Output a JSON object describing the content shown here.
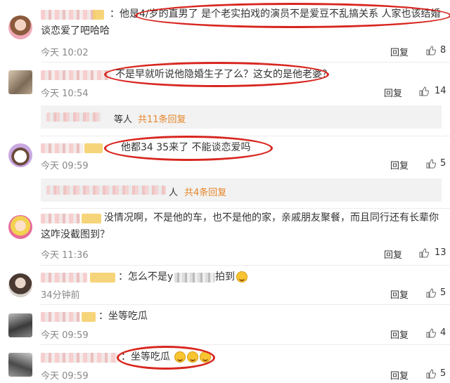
{
  "colors": {
    "accent": "#e5862c",
    "annotation": "#d8261f",
    "time": "#888888"
  },
  "comments": [
    {
      "text_line1": "：他是4/岁的直男了 是个老实拍戏的演员不是爱豆不乱搞关系 人家也该结婚",
      "text_line2": "谈恋爱了吧哈哈",
      "time": "今天 10:02",
      "reply": "回复",
      "likes": "8"
    },
    {
      "text_line1": "不是早就听说他隐婚生子了么？这女的是他老婆？",
      "time": "今天 10:54",
      "reply": "回复",
      "likes": "14",
      "sub_text": "等人",
      "sub_more": "共11条回复"
    },
    {
      "text_line1": "他都34 35来了 不能谈恋爱吗",
      "time": "今天 09:59",
      "reply": "回复",
      "likes": "5",
      "sub_text": "人",
      "sub_more": "共4条回复"
    },
    {
      "text_line1": "没情况啊，不是他的车，也不是他的家，亲戚朋友聚餐，而且同行还有长辈你",
      "text_line2": "这咋没截图到？",
      "time": "今天 11:36",
      "reply": "回复",
      "likes": "13"
    },
    {
      "text_prefix": "：怎么不是y",
      "text_suffix": "拍到",
      "time": "34分钟前",
      "reply": "回复",
      "likes": "5"
    },
    {
      "text_line1": "：坐等吃瓜",
      "time": "今天 09:59",
      "reply": "回复",
      "likes": "4"
    },
    {
      "text_line1": "：坐等吃瓜",
      "time": "今天 09:59",
      "reply": "回复",
      "likes": "5"
    }
  ]
}
